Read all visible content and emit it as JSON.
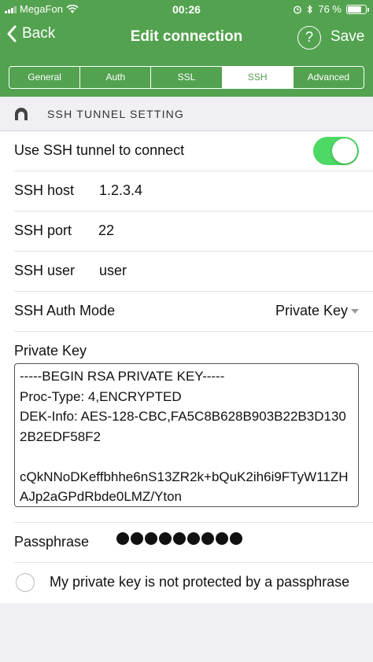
{
  "status": {
    "carrier": "MegaFon",
    "time": "00:26",
    "battery": "76 %",
    "battery_fraction": 0.76
  },
  "nav": {
    "back_label": "Back",
    "title": "Edit connection",
    "help_label": "?",
    "save_label": "Save"
  },
  "tabs": [
    {
      "label": "General",
      "active": false
    },
    {
      "label": "Auth",
      "active": false
    },
    {
      "label": "SSL",
      "active": false
    },
    {
      "label": "SSH",
      "active": true
    },
    {
      "label": "Advanced",
      "active": false
    }
  ],
  "section": {
    "title": "SSH TUNNEL SETTING"
  },
  "form": {
    "use_tunnel_label": "Use SSH tunnel to connect",
    "use_tunnel_on": true,
    "host_label": "SSH host",
    "host_value": "1.2.3.4",
    "port_label": "SSH port",
    "port_value": "22",
    "user_label": "SSH user",
    "user_value": "user",
    "auth_mode_label": "SSH Auth Mode",
    "auth_mode_value": "Private Key",
    "private_key_label": "Private Key",
    "private_key_value": "-----BEGIN RSA PRIVATE KEY-----\nProc-Type: 4,ENCRYPTED\nDEK-Info: AES-128-CBC,FA5C8B628B903B22B3D1302B2EDF58F2\n\ncQkNNoDKeffbhhe6nS13ZR2k+bQuK2ih6i9FTyW11ZHAJp2aGPdRbde0LMZ/Yton",
    "passphrase_label": "Passphrase",
    "passphrase_length": 9,
    "not_protected_label": "My private key is not protected by a passphrase"
  },
  "colors": {
    "accent": "#53a24f",
    "toggle_on": "#4cd964"
  }
}
